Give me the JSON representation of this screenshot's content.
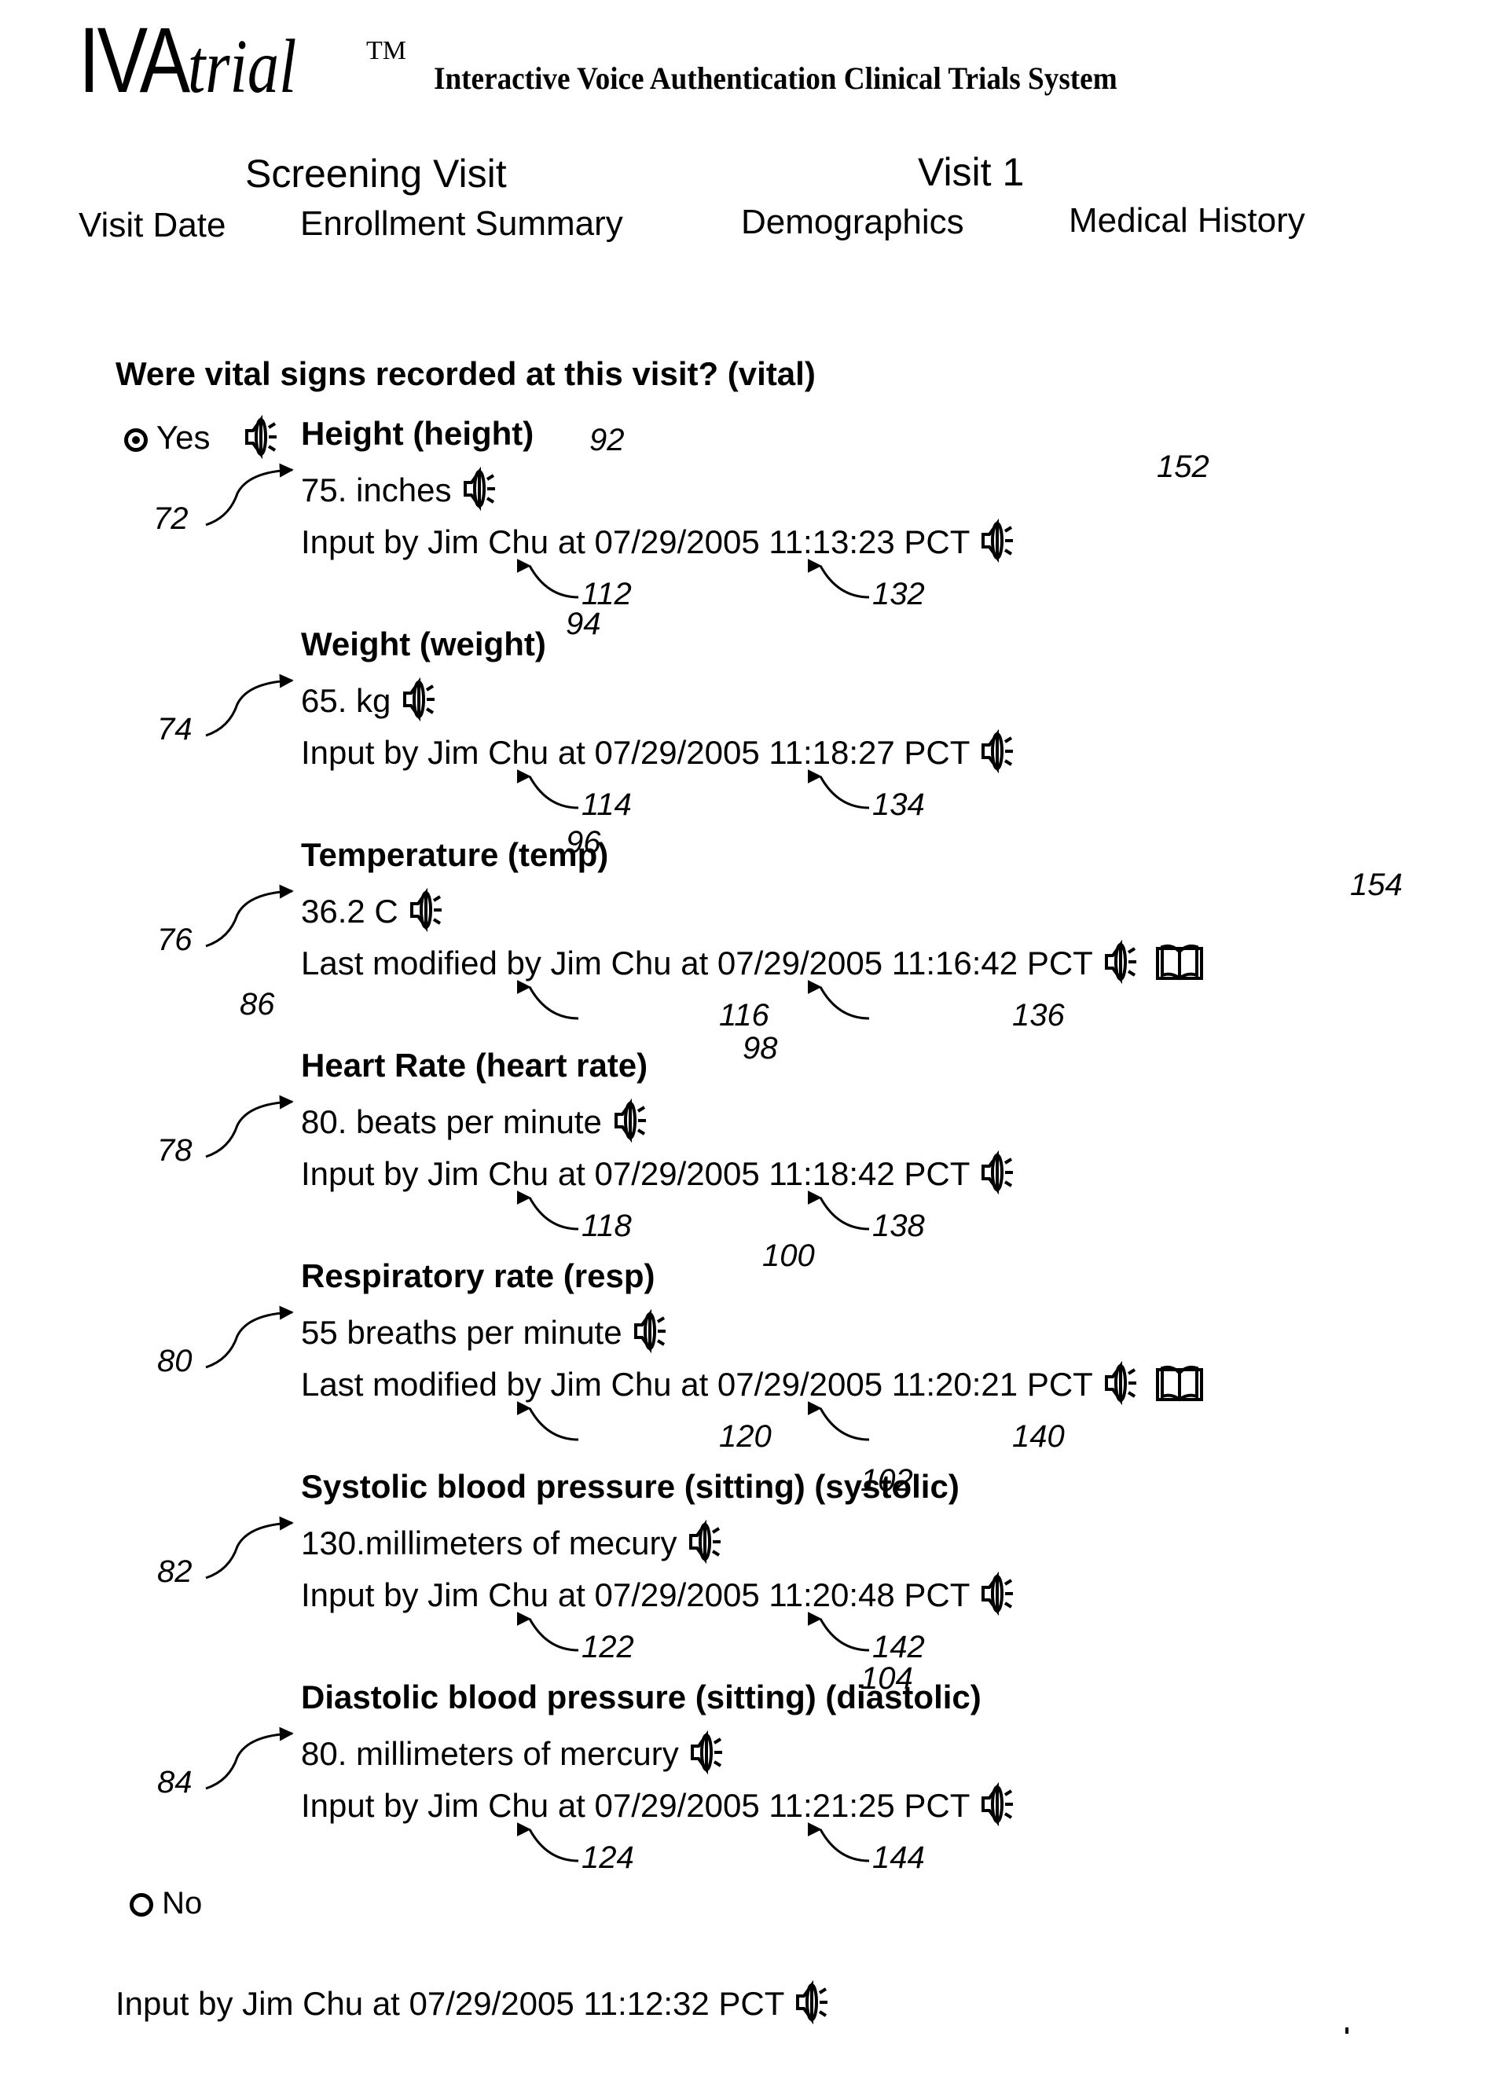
{
  "header": {
    "logo_prefix": "IVA",
    "logo_suffix": "trial",
    "trademark": "TM",
    "tagline": "Interactive Voice Authentication Clinical Trials System"
  },
  "visit": {
    "type_label": "Screening Visit",
    "number_label": "Visit 1"
  },
  "nav": {
    "items": [
      {
        "label": "Visit Date"
      },
      {
        "label": "Enrollment Summary"
      },
      {
        "label": "Demographics"
      },
      {
        "label": "Medical History"
      }
    ]
  },
  "question": {
    "text": "Were vital signs recorded at this visit? (vital)",
    "options": [
      {
        "label": "Yes",
        "selected": true
      },
      {
        "label": "No",
        "selected": false
      }
    ]
  },
  "fields": [
    {
      "title": "Height (height)",
      "value": "75. inches",
      "audit": "Input by Jim Chu at 07/29/2005 11:13:23 PCT",
      "has_history": false,
      "refs": {
        "block": "72",
        "value_audio": "92",
        "user": "112",
        "time": "132",
        "audit_audio": "152"
      }
    },
    {
      "title": "Weight (weight)",
      "value": "65. kg",
      "audit": "Input by Jim Chu at 07/29/2005 11:18:27 PCT",
      "has_history": false,
      "refs": {
        "block": "74",
        "value_audio": "94",
        "user": "114",
        "time": "134"
      }
    },
    {
      "title": "Temperature (temp)",
      "value": "36.2 C",
      "audit": "Last modified by Jim Chu at 07/29/2005 11:16:42 PCT",
      "has_history": true,
      "refs": {
        "block": "76",
        "value_audio": "96",
        "user": "116",
        "time": "136",
        "history": "154",
        "modified": "86"
      }
    },
    {
      "title": "Heart Rate (heart rate)",
      "value": "80. beats per minute",
      "audit": "Input by Jim Chu at 07/29/2005 11:18:42 PCT",
      "has_history": false,
      "refs": {
        "block": "78",
        "value_audio": "98",
        "user": "118",
        "time": "138"
      }
    },
    {
      "title": "Respiratory rate (resp)",
      "value": "55 breaths per minute",
      "audit": "Last modified by Jim Chu at 07/29/2005 11:20:21 PCT",
      "has_history": true,
      "refs": {
        "block": "80",
        "value_audio": "100",
        "user": "120",
        "time": "140"
      }
    },
    {
      "title": "Systolic blood pressure (sitting) (systolic)",
      "value": "130.millimeters of mecury",
      "audit": "Input by Jim Chu at 07/29/2005 11:20:48 PCT",
      "has_history": false,
      "refs": {
        "block": "82",
        "value_audio": "102",
        "user": "122",
        "time": "142"
      }
    },
    {
      "title": "Diastolic blood pressure (sitting) (diastolic)",
      "value": "80. millimeters of mercury",
      "audit": "Input by Jim Chu at 07/29/2005 11:21:25 PCT",
      "has_history": false,
      "refs": {
        "block": "84",
        "value_audio": "104",
        "user": "124",
        "time": "144"
      }
    }
  ],
  "footer": {
    "audit": "Input by Jim Chu at 07/29/2005 11:12:32 PCT"
  }
}
